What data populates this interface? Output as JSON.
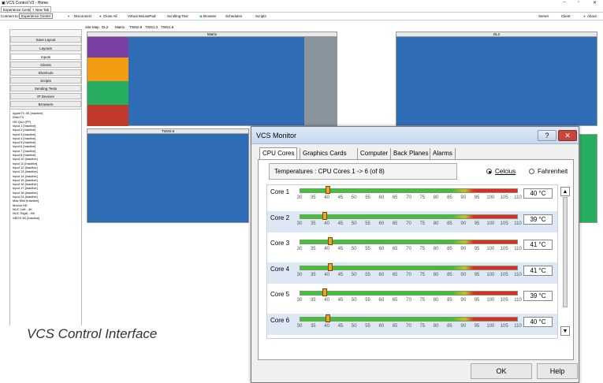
{
  "window": {
    "title": "VCS Control V3 - Home",
    "min": "–",
    "max": "▫",
    "close": "✕"
  },
  "tabs": [
    "Experience Center",
    "+ New Tab"
  ],
  "toolbar": {
    "connect_label": "Connect to:",
    "connect_value": "Experience Center",
    "items": [
      "Disconnect",
      "Close All",
      "Virtual MousePad",
      "Scrolling Text",
      "Browser",
      "Schedules",
      "Scripts"
    ],
    "right_items": [
      "Server",
      "Client",
      "About"
    ]
  },
  "left_buttons": [
    "Save Layout",
    "Layouts",
    "Inputs",
    "Clients",
    "Shortcuts",
    "Scripts",
    "Sending Tests",
    "IP Devices",
    "Browsers"
  ],
  "devices": [
    "AppleTV 4K [Inactive]",
    "DirecTV",
    "HD Quo (FP)",
    "Input 1 [Inactive]",
    "Input 2 [Inactive]",
    "Input 3 [Inactive]",
    "Input 4 [Inactive]",
    "Input 5 [Inactive]",
    "Input 6 [Inactive]",
    "Input 7 [Inactive]",
    "Input 8 [Inactive]",
    "Input 10 [Inactive]",
    "Input 11 [Inactive]",
    "Input 12 [Inactive]",
    "Input 13 [Inactive]",
    "Input 14 [Inactive]",
    "Input 15 [Inactive]",
    "Input 16 [Inactive]",
    "Input 17 [Inactive]",
    "Input 18 [Inactive]",
    "Input 24 [Inactive]",
    "Mac Mini [Inactive]",
    "Mocca HD",
    "NUC Left - 4K",
    "NUC Right - HD",
    "XBOX 4K [Inactive]"
  ],
  "subtabs": [
    "Site Map",
    "DL2",
    "Matrix",
    "TWS0.9",
    "TWS1.2",
    "TWS1.6"
  ],
  "panels": {
    "matrix": "Matrix",
    "dl2": "DL2",
    "tws": "TWS0.9"
  },
  "dialog": {
    "title": "VCS Monitor",
    "help_glyph": "?",
    "close_glyph": "✕",
    "tabs": [
      "CPU Cores",
      "Graphics Cards",
      "Computer",
      "Back Planes",
      "Alarms"
    ],
    "temps_label": "Temperatures : CPU Cores 1 -> 6 (of 8)",
    "unit_celsius": "Celcius",
    "unit_fahrenheit": "Fahrenheit",
    "unit_selected": "Celcius",
    "scale": [
      "30",
      "35",
      "40",
      "45",
      "50",
      "55",
      "60",
      "65",
      "70",
      "75",
      "80",
      "85",
      "90",
      "95",
      "100",
      "105",
      "110"
    ],
    "cores": [
      {
        "label": "Core 1",
        "temp": 40,
        "display": "40 °C"
      },
      {
        "label": "Core 2",
        "temp": 39,
        "display": "39 °C"
      },
      {
        "label": "Core 3",
        "temp": 41,
        "display": "41 °C"
      },
      {
        "label": "Core 4",
        "temp": 41,
        "display": "41 °C"
      },
      {
        "label": "Core 5",
        "temp": 39,
        "display": "39 °C"
      },
      {
        "label": "Core 6",
        "temp": 40,
        "display": "40 °C"
      }
    ],
    "ok": "OK",
    "help": "Help",
    "scroll_up": "▲",
    "scroll_down": "▼"
  },
  "caption": "VCS Control Interface",
  "colors": {
    "accent_blue": "#2e6db5",
    "purple": "#7b3fa3",
    "orange": "#f39c12",
    "green": "#27ae60",
    "red": "#c0392b",
    "gray": "#8a949c"
  }
}
